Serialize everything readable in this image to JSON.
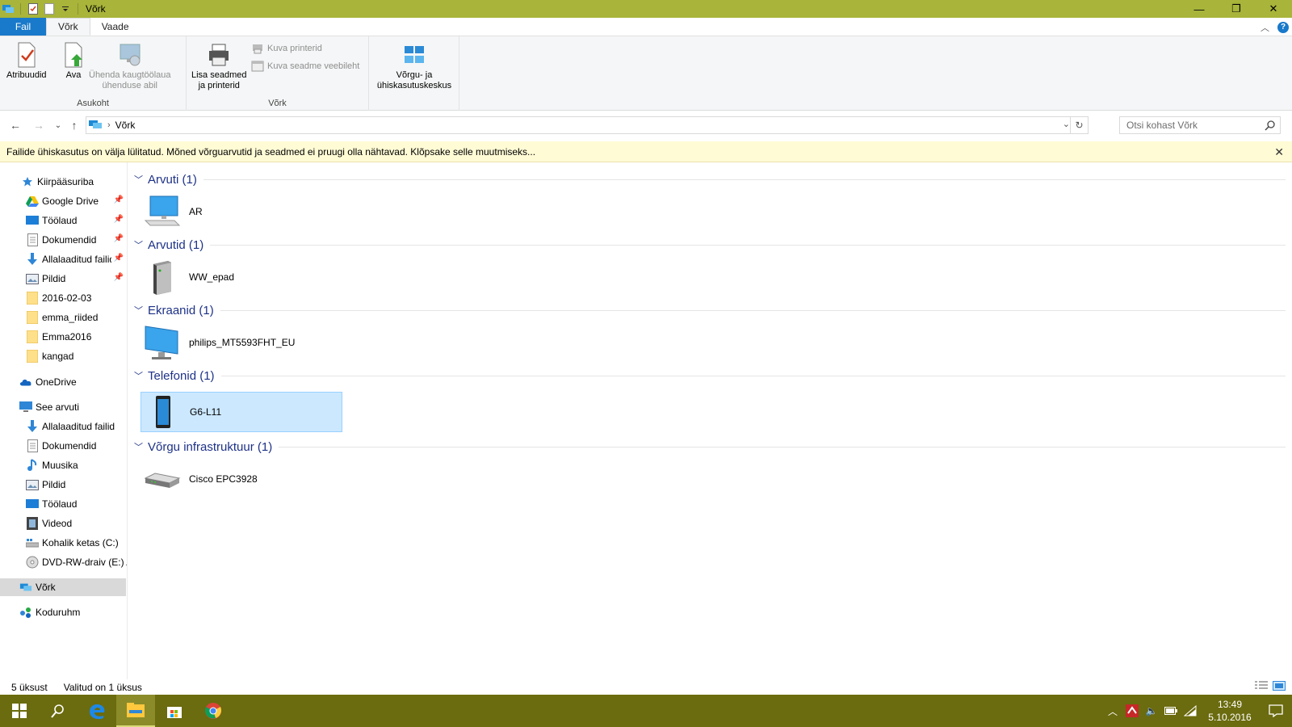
{
  "window": {
    "title": "Võrk",
    "controls": {
      "minimize": "—",
      "maximize": "❐",
      "close": "✕"
    }
  },
  "ribbon": {
    "tabs": [
      {
        "label": "Fail"
      },
      {
        "label": "Võrk"
      },
      {
        "label": "Vaade"
      }
    ],
    "groups": {
      "asukoht": {
        "label": "Asukoht",
        "atribuudid": "Atribuudid",
        "ava": "Ava",
        "uhenda_line1": "Ühenda kaugtöölaua",
        "uhenda_line2": "ühenduse abil"
      },
      "vork": {
        "label": "Võrk",
        "lisa_line1": "Lisa seadmed",
        "lisa_line2": "ja printerid",
        "kuva_printerid": "Kuva printerid",
        "kuva_veebileht": "Kuva seadme veebileht"
      },
      "keskus": {
        "line1": "Võrgu- ja",
        "line2": "ühiskasutuskeskus"
      }
    }
  },
  "address": {
    "path": "Võrk",
    "search_placeholder": "Otsi kohast Võrk"
  },
  "infobar": {
    "text": "Failide ühiskasutus on välja lülitatud. Mõned võrguarvutid ja seadmed ei pruugi olla nähtavad. Klõpsake selle muutmiseks..."
  },
  "sidebar": {
    "items": [
      {
        "label": "Kiirpääsuriba",
        "icon": "star-icon"
      },
      {
        "label": "Google Drive",
        "icon": "google-drive-icon"
      },
      {
        "label": "Töölaud",
        "icon": "desktop-icon"
      },
      {
        "label": "Dokumendid",
        "icon": "documents-icon"
      },
      {
        "label": "Allalaaditud failid",
        "icon": "download-icon"
      },
      {
        "label": "Pildid",
        "icon": "pictures-icon"
      },
      {
        "label": "2016-02-03",
        "icon": "folder-icon"
      },
      {
        "label": "emma_riided",
        "icon": "folder-icon"
      },
      {
        "label": "Emma2016",
        "icon": "folder-icon"
      },
      {
        "label": "kangad",
        "icon": "folder-icon"
      },
      {
        "label": "OneDrive",
        "icon": "onedrive-icon"
      },
      {
        "label": "See arvuti",
        "icon": "computer-icon"
      },
      {
        "label": "Allalaaditud failid",
        "icon": "download-icon"
      },
      {
        "label": "Dokumendid",
        "icon": "documents-icon"
      },
      {
        "label": "Muusika",
        "icon": "music-icon"
      },
      {
        "label": "Pildid",
        "icon": "pictures-icon"
      },
      {
        "label": "Töölaud",
        "icon": "desktop-icon"
      },
      {
        "label": "Videod",
        "icon": "video-icon"
      },
      {
        "label": "Kohalik ketas (C:)",
        "icon": "drive-icon"
      },
      {
        "label": "DVD-RW-draiv (E:) A",
        "icon": "dvd-icon"
      },
      {
        "label": "Võrk",
        "icon": "network-icon"
      },
      {
        "label": "Koduruhm",
        "icon": "homegroup-icon"
      }
    ]
  },
  "groups": [
    {
      "title": "Arvuti (1)",
      "item": "AR",
      "icon": "computer-icon"
    },
    {
      "title": "Arvutid (1)",
      "item": "WW_epad",
      "icon": "server-icon"
    },
    {
      "title": "Ekraanid (1)",
      "item": "philips_MT5593FHT_EU",
      "icon": "monitor-icon"
    },
    {
      "title": "Telefonid (1)",
      "item": "G6-L11",
      "icon": "phone-icon"
    },
    {
      "title": "Võrgu infrastruktuur (1)",
      "item": "Cisco EPC3928",
      "icon": "router-icon"
    }
  ],
  "status": {
    "count": "5 üksust",
    "selected": "Valitud on 1 üksus"
  },
  "taskbar": {
    "time": "13:49",
    "date": "5.10.2016"
  },
  "colors": {
    "titlebar": "#a8b43a",
    "accent": "#1979ca",
    "group_header": "#1e3287",
    "selection": "#cce8ff",
    "taskbar": "#6b6b0f"
  }
}
